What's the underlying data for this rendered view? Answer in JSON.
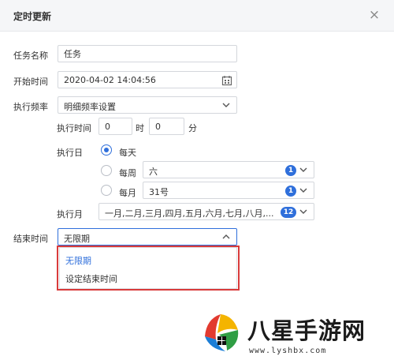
{
  "dialog": {
    "title": "定时更新",
    "close_glyph": "×"
  },
  "task_name": {
    "label": "任务名称",
    "value": "任务"
  },
  "start_time": {
    "label": "开始时间",
    "value": "2020-04-02 14:04:56",
    "icon": "calendar-icon"
  },
  "frequency": {
    "label": "执行频率",
    "value": "明细频率设置"
  },
  "exec_time": {
    "label": "执行时间",
    "hour_value": "0",
    "hour_unit": "时",
    "minute_value": "0",
    "minute_unit": "分"
  },
  "exec_day": {
    "label": "执行日",
    "options": [
      {
        "label": "每天",
        "selected": true
      },
      {
        "label": "每周",
        "selected": false,
        "value": "六",
        "badge": "1"
      },
      {
        "label": "每月",
        "selected": false,
        "value": "31号",
        "badge": "1"
      }
    ]
  },
  "exec_month": {
    "label": "执行月",
    "value": "一月,二月,三月,四月,五月,六月,七月,八月,...",
    "badge": "12"
  },
  "end_time": {
    "label": "结束时间",
    "value": "无限期",
    "options": [
      "无限期",
      "设定结束时间"
    ]
  },
  "watermark": {
    "text": "八星手游网",
    "url": "www.lyshbx.com"
  },
  "colors": {
    "accent": "#2f6fdb",
    "highlight": "#d93b3b",
    "selected_option": "#2f6fdb"
  }
}
